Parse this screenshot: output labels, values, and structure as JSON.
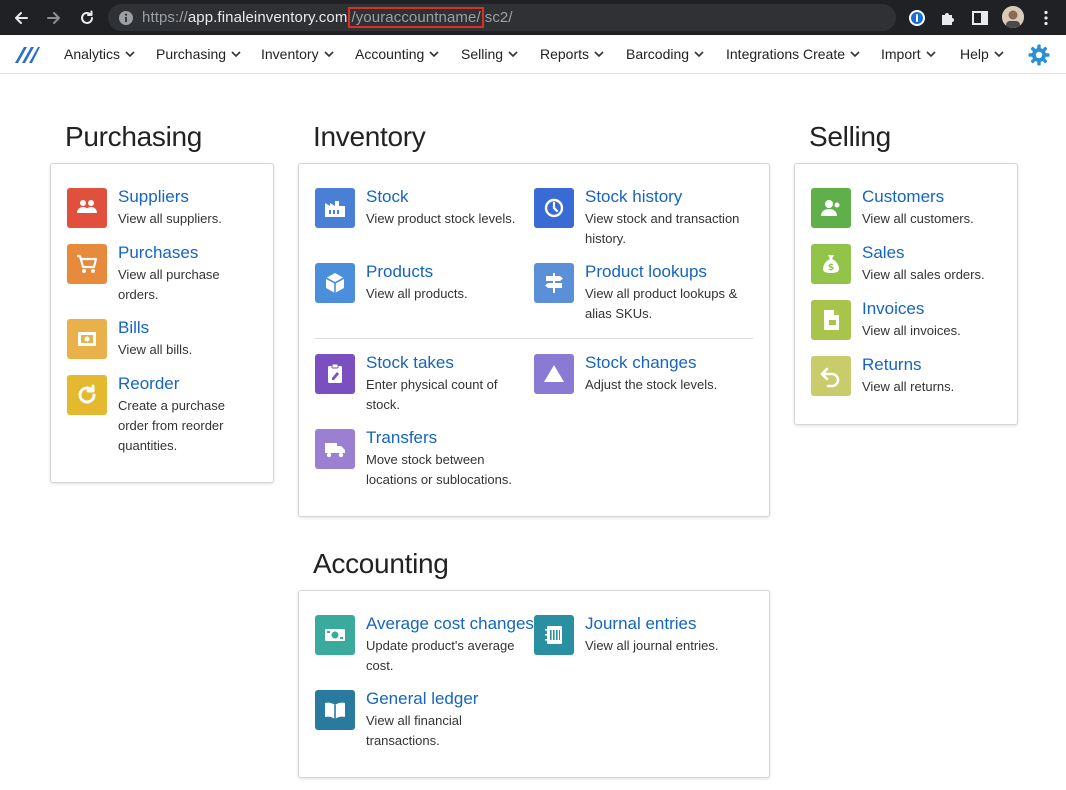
{
  "browser": {
    "url_scheme": "https://",
    "url_host": "app.finaleinventory.com",
    "url_highlight": "/youraccountname/",
    "url_rest": "sc2/"
  },
  "nav": {
    "items": [
      "Analytics",
      "Purchasing",
      "Inventory",
      "Accounting",
      "Selling",
      "Reports",
      "Barcoding",
      "Integrations",
      "Create",
      "Import",
      "Help"
    ]
  },
  "sections": {
    "purchasing": {
      "title": "Purchasing",
      "items": [
        {
          "title": "Suppliers",
          "desc": "View all suppliers."
        },
        {
          "title": "Purchases",
          "desc": "View all purchase orders."
        },
        {
          "title": "Bills",
          "desc": "View all bills."
        },
        {
          "title": "Reorder",
          "desc": "Create a purchase order from reorder quantities."
        }
      ]
    },
    "inventory": {
      "title": "Inventory",
      "items": [
        {
          "title": "Stock",
          "desc": "View product stock levels."
        },
        {
          "title": "Stock history",
          "desc": "View stock and transaction history."
        },
        {
          "title": "Products",
          "desc": "View all products."
        },
        {
          "title": "Product lookups",
          "desc": "View all product lookups & alias SKUs."
        },
        {
          "title": "Stock takes",
          "desc": "Enter physical count of stock."
        },
        {
          "title": "Stock changes",
          "desc": "Adjust the stock levels."
        },
        {
          "title": "Transfers",
          "desc": "Move stock between locations or sublocations."
        }
      ]
    },
    "selling": {
      "title": "Selling",
      "items": [
        {
          "title": "Customers",
          "desc": "View all customers."
        },
        {
          "title": "Sales",
          "desc": "View all sales orders."
        },
        {
          "title": "Invoices",
          "desc": "View all invoices."
        },
        {
          "title": "Returns",
          "desc": "View all returns."
        }
      ]
    },
    "accounting": {
      "title": "Accounting",
      "items": [
        {
          "title": "Average cost changes",
          "desc": "Update product's average cost."
        },
        {
          "title": "Journal entries",
          "desc": "View all journal entries."
        },
        {
          "title": "General ledger",
          "desc": "View all financial transactions."
        }
      ]
    }
  },
  "colors": {
    "browser_bar": "#202124",
    "link": "#1565c0",
    "suppliers": "#e0503c",
    "purchases": "#e88a3c",
    "bills": "#e8b14a",
    "reorder": "#e4b82f",
    "stock": "#4a7fd6",
    "stock_history": "#3a6ad4",
    "products": "#4b8fdc",
    "product_lookups": "#5b8fd8",
    "stock_takes": "#7b4fc0",
    "stock_changes": "#8a7ad4",
    "transfers": "#9b7fd0",
    "customers": "#5fb04a",
    "sales": "#92c449",
    "invoices": "#a8c44a",
    "returns": "#c8cc6a",
    "avg_cost": "#3aaa9c",
    "journal": "#2a8fa0",
    "ledger": "#2a7aa0",
    "gear": "#2a8fd6"
  }
}
